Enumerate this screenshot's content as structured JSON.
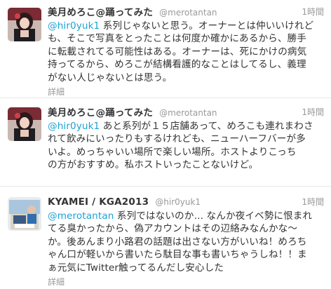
{
  "tweets": [
    {
      "name": "美月めろこ@踊ってみた",
      "handle": "@merotantan",
      "time": "1時間",
      "mention": "@hir0yuk1",
      "lines": [
        " 系列じゃないと思う。オーナーとは仲いいけれど",
        "も、そこで写真をとったことは何度か確かにあるから、勝手",
        "に転載されてる可能性はある。オーナーは、死にかけの病気",
        "持ってるから、めろこが結構看護的なことはしてるし、義理",
        "がない人じゃないとは思う。"
      ],
      "details": "詳細"
    },
    {
      "name": "美月めろこ@踊ってみた",
      "handle": "@merotantan",
      "time": "1時間",
      "mention": "@hir0yuk1",
      "lines": [
        " あと系列が１５店舗あって、めろこも連れまわさ",
        "れて飲みにいったりもするけれども、ニューハーフバーが多",
        "いよ。めっちゃいい場所で楽しい場所。ホストよりこっち",
        "の方がおすすめ。私ホストいったことないけど。"
      ],
      "details": "詳細"
    },
    {
      "name": "KYAMEI / KGA2013",
      "handle": "@hir0yuk1",
      "time": "1時間",
      "mention": "@merotantan",
      "lines": [
        " 系列ではないのか… なんか夜イベ勢に恨まれ",
        "てる臭かったから、偽アカウントはその辺絡みなんかな〜",
        "か。後あんまり小路君の話題は出さない方がいいね！めろち",
        "ゃん口が軽いから書いたら駄目な事も書いちゃうしね！！ま",
        "ぁ元気にTwitter触ってるんだし安心した"
      ],
      "details": "詳細"
    }
  ],
  "colors": {
    "mention": "#1da1d8",
    "muted": "#999999",
    "text": "#333333"
  }
}
